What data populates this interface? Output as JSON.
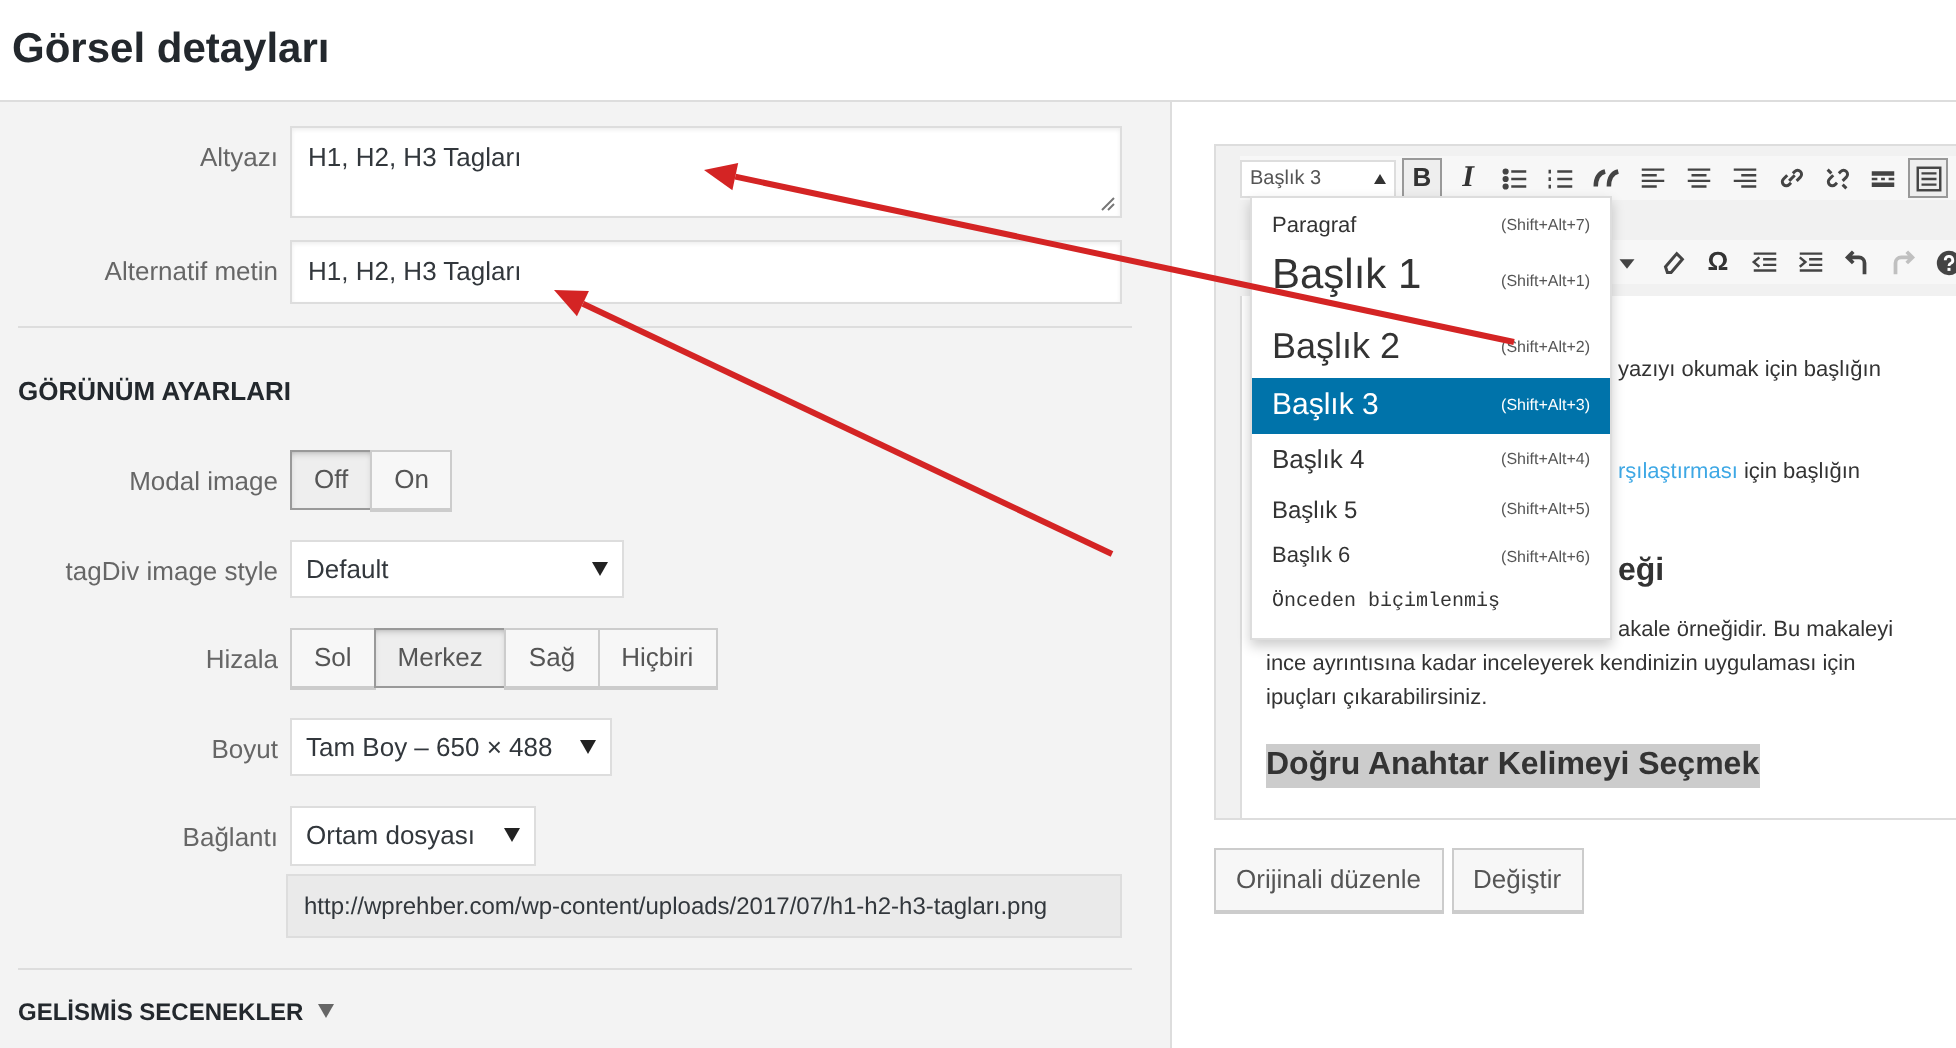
{
  "window": {
    "title": "Görsel detayları"
  },
  "fields": [
    {
      "label": "Altyazı",
      "kind": "textarea",
      "value": "H1, H2, H3 Tagları"
    },
    {
      "label": "Alternatif metin",
      "kind": "text",
      "value": "H1, H2, H3 Tagları"
    }
  ],
  "display_settings": {
    "heading": "GÖRÜNÜM AYARLARI",
    "rows": [
      {
        "label": "Modal image",
        "kind": "buttons",
        "options": [
          {
            "label": "Off",
            "selected": true
          },
          {
            "label": "On",
            "selected": false
          }
        ]
      },
      {
        "label": "tagDiv image style",
        "kind": "select",
        "value": "Default"
      },
      {
        "label": "Hizala",
        "kind": "buttons",
        "options": [
          {
            "label": "Sol",
            "selected": false
          },
          {
            "label": "Merkez",
            "selected": true
          },
          {
            "label": "Sağ",
            "selected": false
          },
          {
            "label": "Hiçbiri",
            "selected": false
          }
        ]
      },
      {
        "label": "Boyut",
        "kind": "select",
        "value": "Tam Boy – 650 × 488"
      },
      {
        "label": "Bağlantı",
        "kind": "select",
        "value": "Ortam dosyası",
        "url": "http://wprehber.com/wp-content/uploads/2017/07/h1-h2-h3-tagları.png"
      }
    ]
  },
  "advanced": {
    "heading": "GELİSMİS SECENEKLER"
  },
  "preview": {
    "format_select": "Başlık 3",
    "toolbar_1": [
      {
        "kind": "glyph",
        "text": "B",
        "selected": true
      },
      {
        "kind": "italic-glyph",
        "text": "I",
        "selected": false
      },
      {
        "kind": "bullet-list",
        "selected": false
      },
      {
        "kind": "numbered-list",
        "selected": false
      },
      {
        "kind": "quote",
        "selected": false
      },
      {
        "kind": "align-left",
        "selected": false
      },
      {
        "kind": "align-center",
        "selected": false
      },
      {
        "kind": "align-right",
        "selected": false
      },
      {
        "kind": "link",
        "selected": false
      },
      {
        "kind": "unlink",
        "selected": false
      },
      {
        "kind": "more",
        "selected": false
      },
      {
        "kind": "toolbar-toggle",
        "selected": true
      }
    ],
    "toolbar_2": [
      {
        "kind": "caret",
        "disabled": false
      },
      {
        "kind": "eraser",
        "disabled": false
      },
      {
        "kind": "glyph",
        "text": "Ω",
        "disabled": false
      },
      {
        "kind": "outdent",
        "disabled": false
      },
      {
        "kind": "indent",
        "disabled": false
      },
      {
        "kind": "undo",
        "disabled": false
      },
      {
        "kind": "redo",
        "disabled": true
      },
      {
        "kind": "help",
        "disabled": false
      }
    ],
    "format_menu": [
      {
        "kind": "p",
        "label": "Paragraf",
        "shortcut": "(Shift+Alt+7)",
        "selected": false
      },
      {
        "kind": "h1",
        "label": "Başlık 1",
        "shortcut": "(Shift+Alt+1)",
        "selected": false
      },
      {
        "kind": "h2",
        "label": "Başlık 2",
        "shortcut": "(Shift+Alt+2)",
        "selected": false
      },
      {
        "kind": "h3",
        "label": "Başlık 3",
        "shortcut": "(Shift+Alt+3)",
        "selected": true
      },
      {
        "kind": "h4",
        "label": "Başlık 4",
        "shortcut": "(Shift+Alt+4)",
        "selected": false
      },
      {
        "kind": "h5",
        "label": "Başlık 5",
        "shortcut": "(Shift+Alt+5)",
        "selected": false
      },
      {
        "kind": "h6",
        "label": "Başlık 6",
        "shortcut": "(Shift+Alt+6)",
        "selected": false
      },
      {
        "kind": "pre",
        "label": "Önceden biçimlenmiş",
        "selected": false
      }
    ],
    "content": [
      {
        "kind": "side-text",
        "parts": [
          {
            "text": "yazıyı okumak için başlığın",
            "link": false
          }
        ]
      },
      {
        "kind": "side-text",
        "parts": [
          {
            "text": "rşılaştırması",
            "link": true
          },
          {
            "text": " için başlığın",
            "link": false
          }
        ]
      },
      {
        "kind": "side-heading",
        "parts": [
          {
            "text": "eği",
            "link": false
          }
        ]
      },
      {
        "kind": "side-text",
        "parts": [
          {
            "text": "akale örneğidir. Bu makaleyi",
            "link": false
          }
        ]
      },
      {
        "kind": "text",
        "parts": [
          {
            "text": "ince ayrıntısına kadar inceleyerek kendinizin uygulaması için",
            "link": false
          }
        ]
      },
      {
        "kind": "text",
        "parts": [
          {
            "text": "ipuçları çıkarabilirsiniz.",
            "link": false
          }
        ]
      },
      {
        "kind": "heading-highlight",
        "parts": [
          {
            "text": "Doğru Anahtar Kelimeyi Seçmek",
            "link": false
          }
        ]
      }
    ],
    "buttons": [
      "Orijinali düzenle",
      "Değiştir"
    ]
  }
}
